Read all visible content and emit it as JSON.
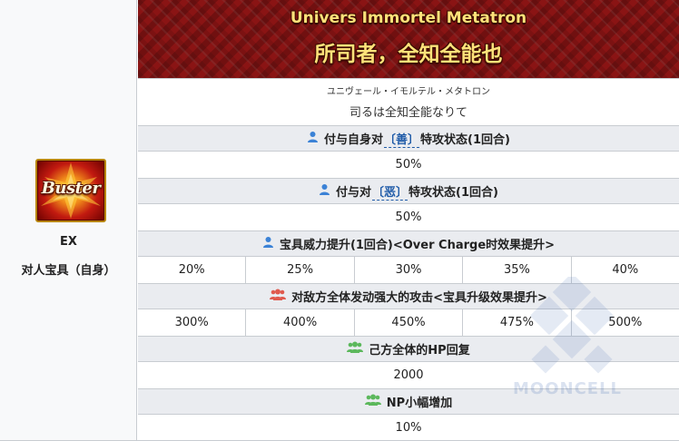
{
  "np": {
    "card_type": "Buster",
    "rank": "EX",
    "type": "对人宝具（自身）",
    "ruby": "Univers Immortel Metatron",
    "name": "所司者，全知全能也",
    "reading_ruby": "ユニヴェール・イモルテル・メタトロン",
    "reading": "司るは全知全能なりて"
  },
  "effects": [
    {
      "icon": "person-icon",
      "icon_color": "#3b82d6",
      "label_before": "付与自身对",
      "tag": "〔善〕",
      "label_after": "特攻状态(1回合)",
      "values": [
        "50%"
      ]
    },
    {
      "icon": "person-icon",
      "icon_color": "#3b82d6",
      "label_before": "付与对",
      "tag": "〔恶〕",
      "label_after": "特攻状态(1回合)",
      "values": [
        "50%"
      ]
    },
    {
      "icon": "person-icon",
      "icon_color": "#3b82d6",
      "label_before": "宝具威力提升(1回合)<Over Charge时效果提升>",
      "tag": "",
      "label_after": "",
      "values": [
        "20%",
        "25%",
        "30%",
        "35%",
        "40%"
      ]
    },
    {
      "icon": "enemy-group-icon",
      "icon_color": "#e05a4e",
      "label_before": "对敌方全体发动强大的攻击<宝具升级效果提升>",
      "tag": "",
      "label_after": "",
      "values": [
        "300%",
        "400%",
        "450%",
        "475%",
        "500%"
      ]
    },
    {
      "icon": "ally-group-icon",
      "icon_color": "#5cb85c",
      "label_before": "己方全体的HP回复",
      "tag": "",
      "label_after": "",
      "values": [
        "2000"
      ]
    },
    {
      "icon": "ally-group-icon",
      "icon_color": "#5cb85c",
      "label_before": "NP小幅增加",
      "tag": "",
      "label_after": "",
      "values": [
        "10%"
      ]
    }
  ],
  "watermark": "MOONCELL",
  "colors": {
    "banner_bg": "#8a1414",
    "banner_text": "#ffe27a",
    "header_row_bg": "#eaecf0",
    "tag_link": "#1f5ba8",
    "border": "#c8ccd1"
  }
}
